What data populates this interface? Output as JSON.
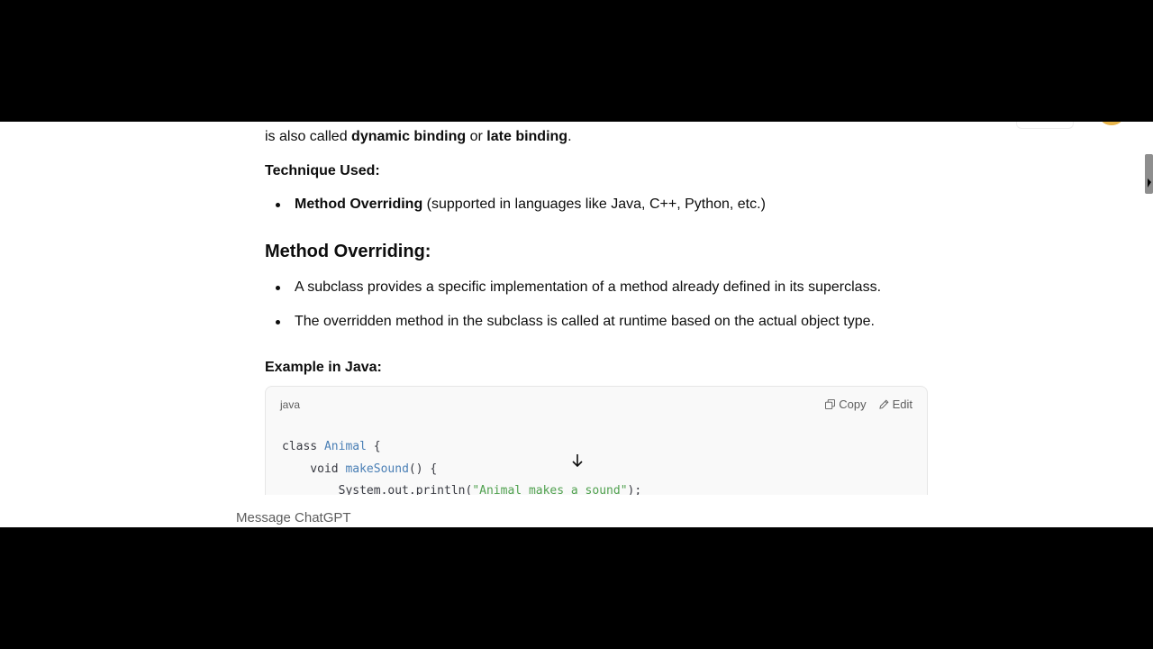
{
  "article": {
    "cut_line_prefix": "is also called ",
    "cut_line_bold1": "dynamic binding",
    "cut_line_mid": " or ",
    "cut_line_bold2": "late binding",
    "cut_line_suffix": ".",
    "technique_label": "Technique Used:",
    "technique_bullet_bold": "Method Overriding",
    "technique_bullet_rest": " (supported in languages like Java, C++, Python, etc.)",
    "heading": "Method Overriding:",
    "bullets": [
      "A subclass provides a specific implementation of a method already defined in its superclass.",
      "The overridden method in the subclass is called at runtime based on the actual object type."
    ],
    "example_label": "Example in Java:"
  },
  "code_block": {
    "language": "java",
    "copy_label": "Copy",
    "edit_label": "Edit",
    "line1_kw": "class ",
    "line1_name": "Animal",
    "line1_rest": " {",
    "line2_kw": "    void ",
    "line2_fn": "makeSound",
    "line2_rest": "() {",
    "line3_pre": "        System.out.println(",
    "line3_str": "\"Animal makes a sound\"",
    "line3_rest": ");"
  },
  "composer": {
    "placeholder": "Message ChatGPT"
  },
  "icons": {
    "copy": "copy-icon",
    "edit": "edit-pencil-icon",
    "scroll_down": "arrow-down-icon"
  }
}
